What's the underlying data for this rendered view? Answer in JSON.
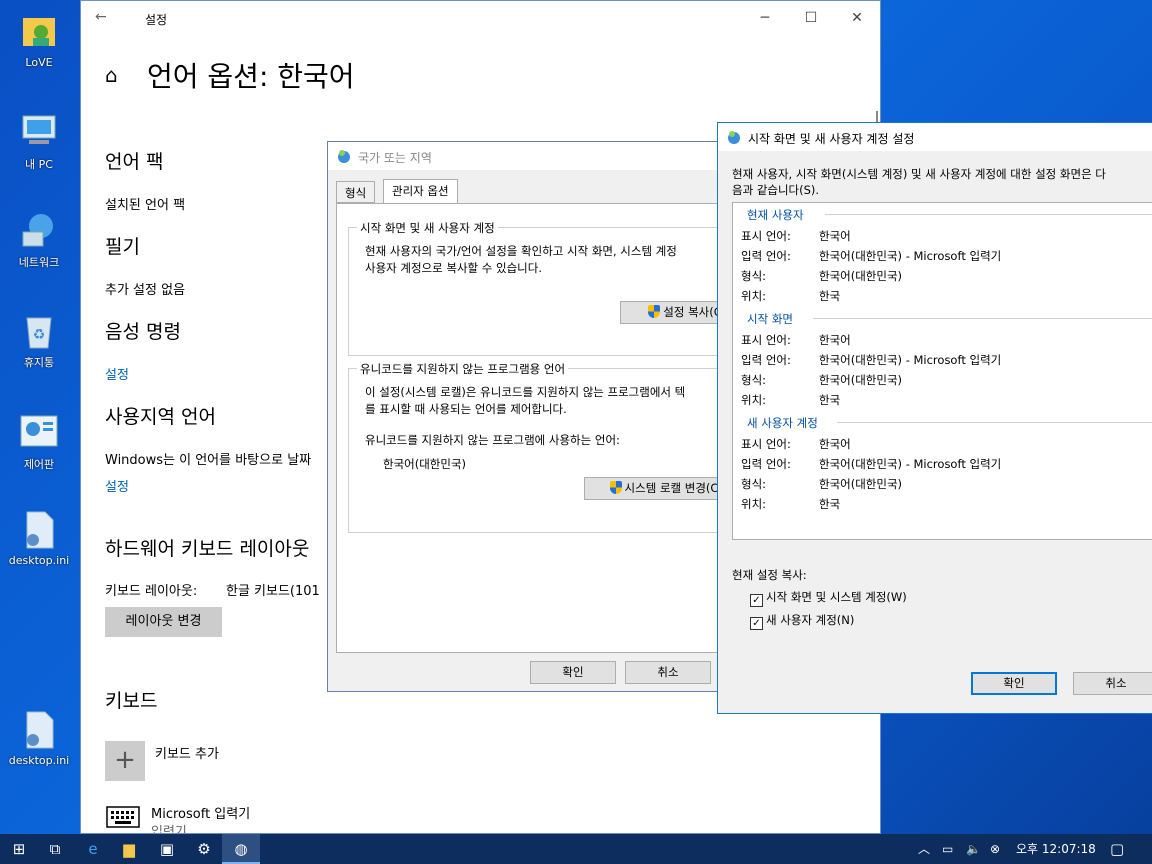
{
  "desktop": {
    "icons": [
      {
        "label": "LoVE",
        "icon": "user-folder-icon"
      },
      {
        "label": "내 PC",
        "icon": "computer-icon"
      },
      {
        "label": "네트워크",
        "icon": "network-icon"
      },
      {
        "label": "휴지통",
        "icon": "recycle-bin-icon"
      },
      {
        "label": "제어판",
        "icon": "control-panel-icon"
      },
      {
        "label": "desktop.ini",
        "icon": "settings-file-icon"
      },
      {
        "label": "desktop.ini",
        "icon": "settings-file-icon"
      }
    ]
  },
  "settings": {
    "window_title": "설정",
    "page_title": "언어 옵션: 한국어",
    "language_pack": {
      "heading": "언어 팩",
      "value": "설치된 언어 팩"
    },
    "handwriting": {
      "heading": "필기",
      "value": "추가 설정 없음"
    },
    "voice": {
      "heading": "음성 명령",
      "link": "설정"
    },
    "regional": {
      "heading": "사용지역 언어",
      "desc": "Windows는 이 언어를 바탕으로 날짜",
      "link": "설정"
    },
    "hw_keyboard": {
      "heading": "하드웨어 키보드 레이아웃",
      "layout_label": "키보드 레이아웃:",
      "layout_value": "한글 키보드(101",
      "button": "레이아웃 변경"
    },
    "keyboards": {
      "heading": "키보드",
      "add_label": "키보드 추가",
      "ime_name": "Microsoft 입력기",
      "ime_sub": "입력기"
    }
  },
  "region_dialog": {
    "title": "국가 또는 지역",
    "tabs": [
      "형식",
      "관리자 옵션"
    ],
    "welcome_group": {
      "label": "시작 화면 및 새 사용자 계정",
      "text1": "현재 사용자의 국가/언어 설정을 확인하고 시작 화면, 시스템 계정",
      "text2": "사용자 계정으로 복사할 수 있습니다.",
      "button": "설정 복사(C"
    },
    "unicode_group": {
      "label": "유니코드를 지원하지 않는 프로그램용 언어",
      "text1": "이 설정(시스템 로캘)은 유니코드를 지원하지 않는 프로그램에서 텍",
      "text2": "를 표시할 때 사용되는 언어를 제어합니다.",
      "current_label": "유니코드를 지원하지 않는 프로그램에 사용하는 언어:",
      "current_value": "한국어(대한민국)",
      "button": "시스템 로캘 변경(C"
    },
    "ok": "확인",
    "cancel": "취소"
  },
  "copy_dialog": {
    "title": "시작 화면 및 새 사용자 계정 설정",
    "intro1": "현재 사용자, 시작 화면(시스템 계정) 및 새 사용자 계정에 대한 설정 화면은 다",
    "intro2": "음과 같습니다(S).",
    "labels": {
      "display": "표시 언어:",
      "input": "입력 언어:",
      "format": "형식:",
      "location": "위치:"
    },
    "sections": [
      {
        "header": "현재 사용자",
        "display": "한국어",
        "input": "한국어(대한민국) - Microsoft 입력기",
        "format": "한국어(대한민국)",
        "location": "한국"
      },
      {
        "header": "시작 화면",
        "display": "한국어",
        "input": "한국어(대한민국) - Microsoft 입력기",
        "format": "한국어(대한민국)",
        "location": "한국"
      },
      {
        "header": "새 사용자 계정",
        "display": "한국어",
        "input": "한국어(대한민국) - Microsoft 입력기",
        "format": "한국어(대한민국)",
        "location": "한국"
      }
    ],
    "copy_label": "현재 설정 복사:",
    "checkbox_welcome": "시작 화면 및 시스템 계정(W)",
    "checkbox_newuser": "새 사용자 계정(N)",
    "ok": "확인",
    "cancel": "취소"
  },
  "taskbar": {
    "clock": "오후 12:07:18",
    "ime_indicator": "가",
    "accent": "#0d2d5e"
  }
}
